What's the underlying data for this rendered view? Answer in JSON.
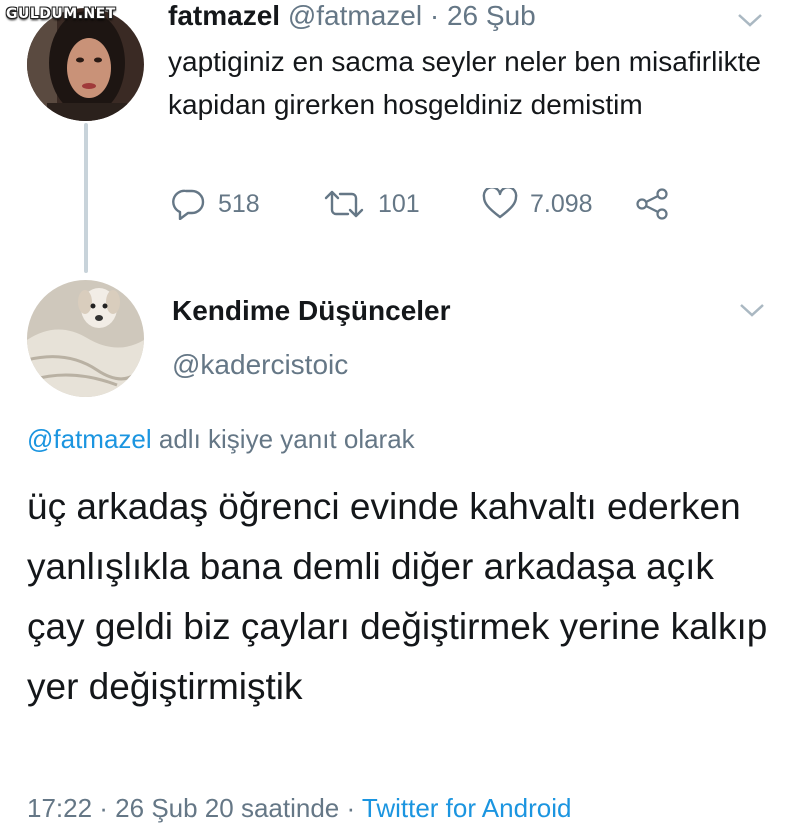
{
  "watermark": "GULDUM.NET",
  "tweet1": {
    "display_name": "fatmazel",
    "handle": "@fatmazel",
    "separator": "·",
    "date": "26 Şub",
    "text": "yaptiginiz en sacma seyler neler ben misafirlikte kapidan girerken hosgeldiniz demistim",
    "replies": "518",
    "retweets": "101",
    "likes": "7.098",
    "icons": [
      "reply-icon",
      "retweet-icon",
      "like-icon",
      "share-icon",
      "chevron-down-icon"
    ]
  },
  "tweet2": {
    "display_name": "Kendime Düşünceler",
    "handle": "@kadercistoic",
    "reply_to_handle": "@fatmazel",
    "reply_to_suffix": "adlı kişiye yanıt olarak",
    "text": "üç arkadaş öğrenci evinde kahvaltı ederken yanlışlıkla bana demli diğer arkadaşa açık çay geldi biz çayları değiştirmek yerine kalkıp yer değiştirmiştik",
    "timestamp": "17:22 · 26 Şub 20 saatinde ·",
    "source": "Twitter for Android"
  },
  "colors": {
    "link": "#1b95e0",
    "muted": "#657786",
    "text": "#14171a",
    "thread": "#c8d3da"
  }
}
